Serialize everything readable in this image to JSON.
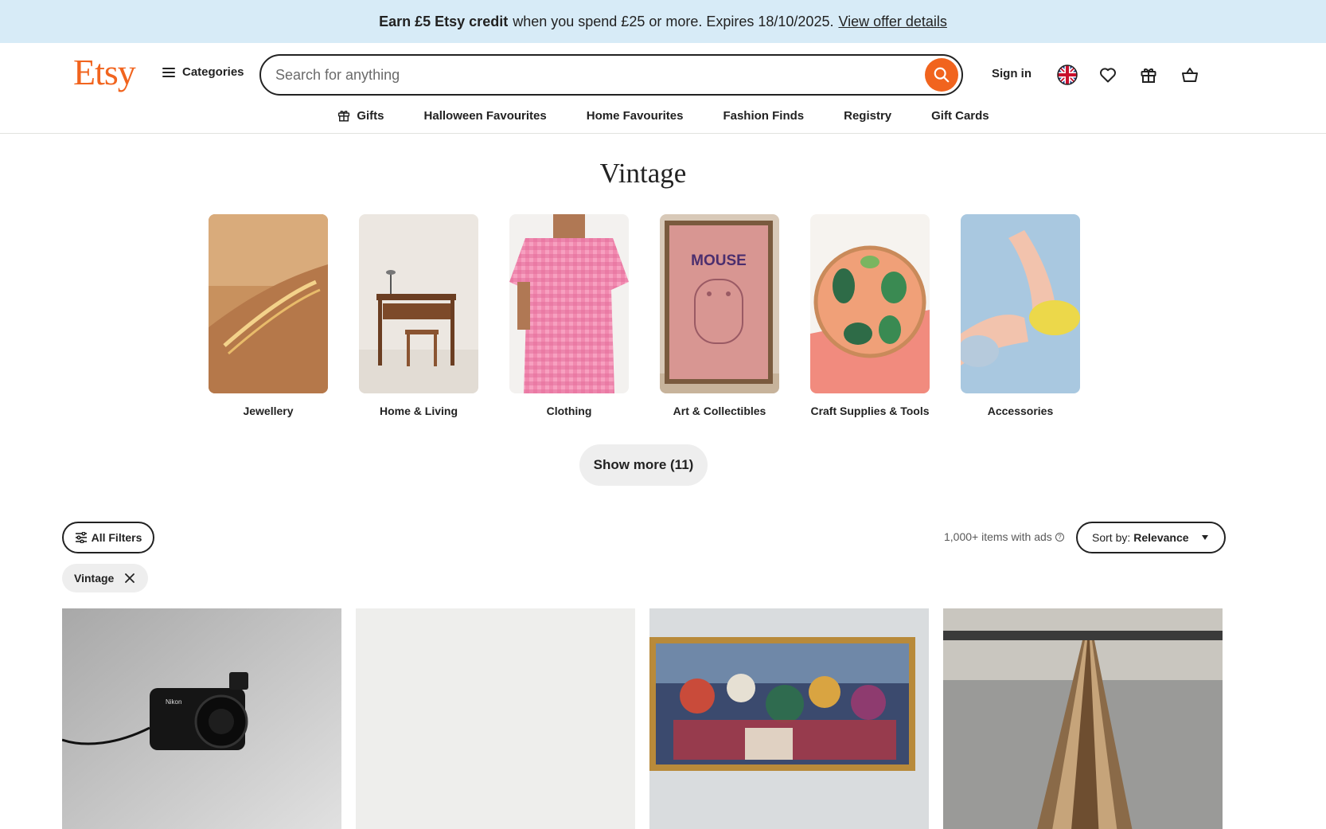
{
  "banner": {
    "bold": "Earn £5 Etsy credit",
    "text": "when you spend £25 or more. Expires 18/10/2025.",
    "link": "View offer details"
  },
  "header": {
    "logo": "Etsy",
    "categories_label": "Categories",
    "search_placeholder": "Search for anything",
    "signin_label": "Sign in",
    "icons": [
      "uk-flag-icon",
      "heart-icon",
      "gift-icon",
      "basket-icon"
    ]
  },
  "nav": {
    "items": [
      "Gifts",
      "Halloween Favourites",
      "Home Favourites",
      "Fashion Finds",
      "Registry",
      "Gift Cards"
    ]
  },
  "page": {
    "title": "Vintage"
  },
  "categories": [
    {
      "label": "Jewellery"
    },
    {
      "label": "Home & Living"
    },
    {
      "label": "Clothing"
    },
    {
      "label": "Art & Collectibles"
    },
    {
      "label": "Craft Supplies & Tools"
    },
    {
      "label": "Accessories"
    }
  ],
  "show_more": "Show more (11)",
  "filters": {
    "all_filters_label": "All Filters",
    "results_count": "1,000+ items with ads",
    "sort_prefix": "Sort by:",
    "sort_value": "Relevance",
    "active_chip": "Vintage"
  },
  "colors": {
    "brand": "#f1641e",
    "banner_bg": "#d7ebf7"
  }
}
